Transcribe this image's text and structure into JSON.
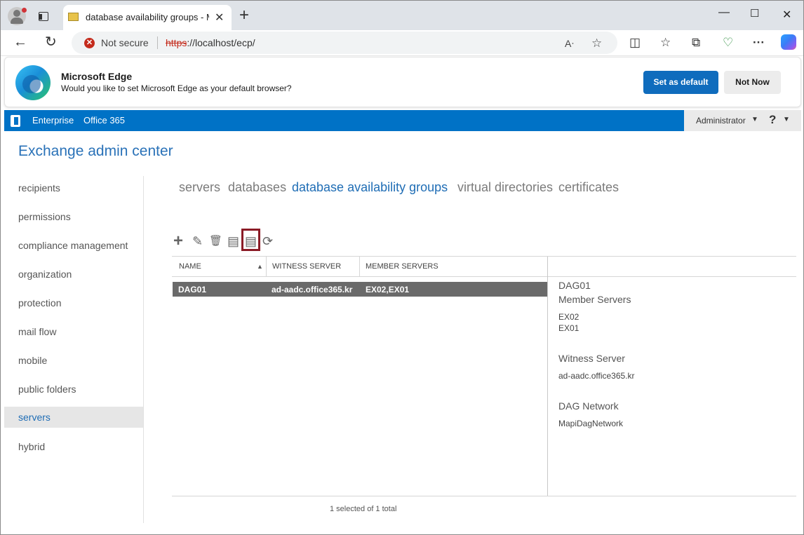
{
  "browser": {
    "tab_title": "database availability groups - Mic",
    "tab_close": "✕",
    "new_tab": "+",
    "security_label": "Not secure",
    "url_scheme": "https",
    "url_rest": "://localhost/ecp/",
    "window_controls": {
      "minimize": "—",
      "maximize": "☐",
      "close": "✕"
    }
  },
  "banner": {
    "title": "Microsoft Edge",
    "message": "Would you like to set Microsoft Edge as your default browser?",
    "set_default_label": "Set as default",
    "not_now_label": "Not Now"
  },
  "eac": {
    "tabs": [
      "Enterprise",
      "Office 365"
    ],
    "user": "Administrator",
    "help": "?",
    "title": "Exchange admin center"
  },
  "leftnav": {
    "items": [
      "recipients",
      "permissions",
      "compliance management",
      "organization",
      "protection",
      "mail flow",
      "mobile",
      "public folders",
      "servers",
      "hybrid"
    ],
    "active": "servers"
  },
  "subtabs": {
    "items": [
      "servers",
      "databases",
      "database availability groups",
      "virtual directories",
      "certificates"
    ],
    "active": "database availability groups"
  },
  "toolbar": {
    "icons": [
      "add-icon",
      "edit-icon",
      "delete-icon",
      "manage-membership-icon",
      "configure-network-icon",
      "refresh-icon"
    ],
    "glyphs": {
      "add": "+",
      "edit": "✎",
      "delete": "🗑",
      "manage": "▤",
      "network": "▤",
      "refresh": "⟳"
    },
    "highlighted": "configure-network-icon"
  },
  "table": {
    "columns": [
      "NAME",
      "WITNESS SERVER",
      "MEMBER SERVERS"
    ],
    "sort_column": "NAME",
    "sort_glyph": "▲",
    "rows": [
      {
        "name": "DAG01",
        "witness": "ad-aadc.office365.kr",
        "members": "EX02,EX01",
        "selected": true
      }
    ],
    "status": "1 selected of 1 total"
  },
  "details": {
    "name": "DAG01",
    "member_servers_label": "Member Servers",
    "member_servers": [
      "EX02",
      "EX01"
    ],
    "witness_label": "Witness Server",
    "witness": "ad-aadc.office365.kr",
    "network_label": "DAG Network",
    "network": "MapiDagNetwork"
  },
  "colors": {
    "eac_blue": "#0072c6",
    "link_blue": "#1f6db5",
    "highlight_box": "#8b1b26",
    "selected_row": "#6a6a6a",
    "edge_button": "#0f6cbd"
  }
}
